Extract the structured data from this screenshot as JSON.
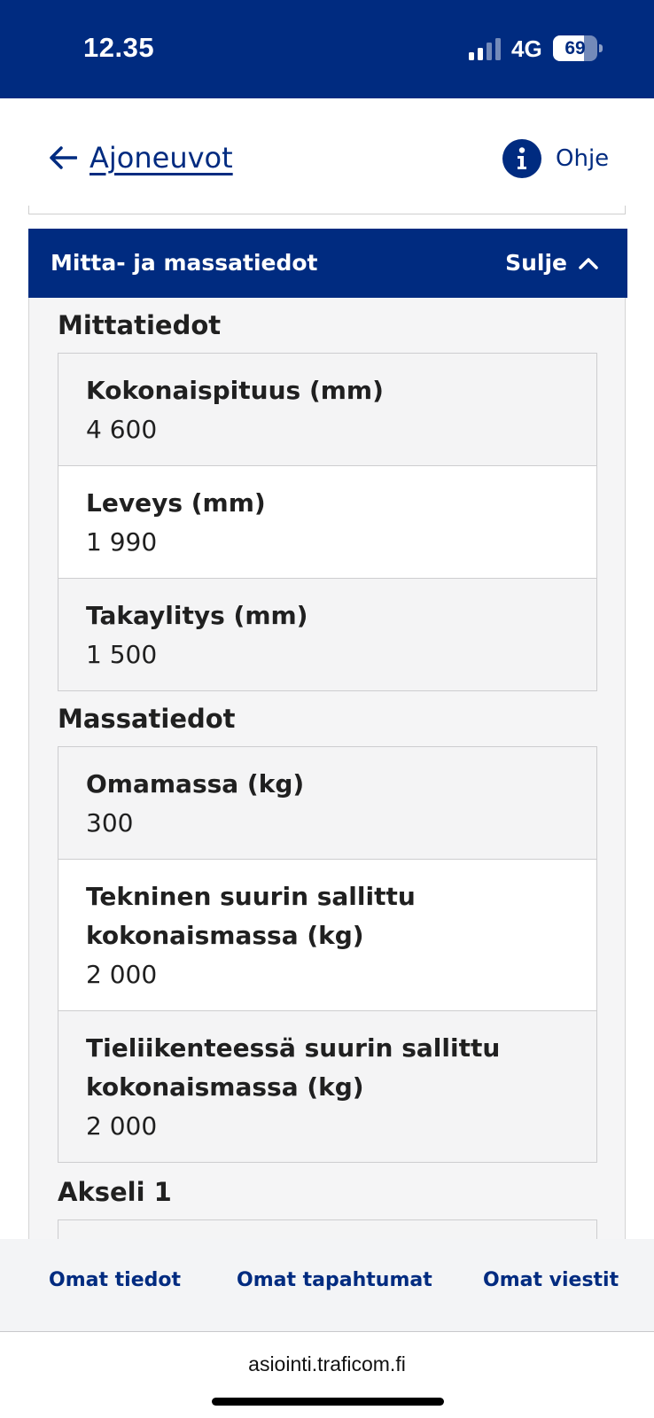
{
  "status_bar": {
    "time": "12.35",
    "network": "4G",
    "battery_percent": "69",
    "battery_level": 0.69,
    "signal_bars_active": 2,
    "signal_bars_total": 4
  },
  "header": {
    "back_label": "Ajoneuvot",
    "help_label": "Ohje",
    "back_icon": "arrow-left-icon",
    "help_icon": "info-icon"
  },
  "section": {
    "title": "Mitta- ja massatiedot",
    "collapse_label": "Sulje",
    "collapse_icon": "chevron-up-icon"
  },
  "groups": {
    "dimensions": {
      "title": "Mittatiedot",
      "fields": [
        {
          "label": "Kokonaispituus (mm)",
          "value": "4 600"
        },
        {
          "label": "Leveys (mm)",
          "value": "1 990"
        },
        {
          "label": "Takaylitys (mm)",
          "value": "1 500"
        }
      ]
    },
    "masses": {
      "title": "Massatiedot",
      "fields": [
        {
          "label": "Omamassa (kg)",
          "value": "300"
        },
        {
          "label": "Tekninen suurin sallittu kokonaismassa (kg)",
          "value": "2 000"
        },
        {
          "label": "Tieliikenteessä suurin sallittu kokonaismassa (kg)",
          "value": "2 000"
        }
      ]
    },
    "axle": {
      "title": "Akseli 1"
    }
  },
  "bottom_nav": {
    "items": [
      {
        "label": "Omat tiedot"
      },
      {
        "label": "Omat tapahtumat"
      },
      {
        "label": "Omat viestit"
      }
    ]
  },
  "browser": {
    "url": "asiointi.traficom.fi"
  },
  "colors": {
    "brand": "#002b80",
    "panel": "#f5f5f6",
    "border": "#cdcdcf"
  }
}
